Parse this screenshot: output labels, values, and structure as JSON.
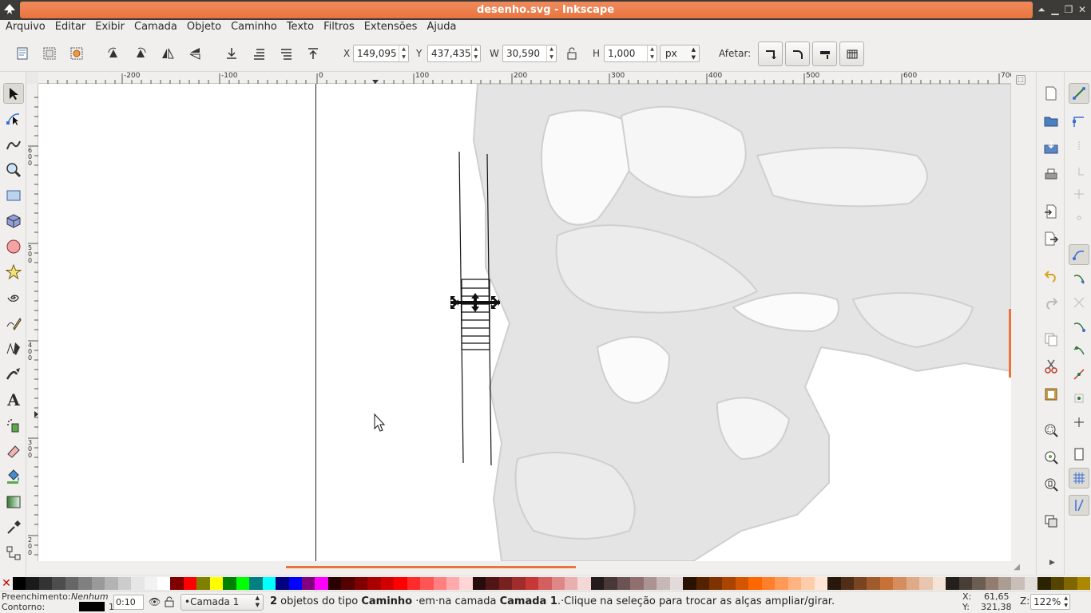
{
  "window": {
    "title": "desenho.svg - Inkscape"
  },
  "menu": [
    "Arquivo",
    "Editar",
    "Exibir",
    "Camada",
    "Objeto",
    "Caminho",
    "Texto",
    "Filtros",
    "Extensões",
    "Ajuda"
  ],
  "toolbar": {
    "x_label": "X",
    "x_value": "149,095",
    "y_label": "Y",
    "y_value": "437,435",
    "w_label": "W",
    "w_value": "30,590",
    "h_label": "H",
    "h_value": "1,000",
    "unit": "px",
    "affect_label": "Afetar:"
  },
  "ruler": {
    "h_ticks": [
      "-200",
      "-100",
      "0",
      "100",
      "200",
      "300",
      "400",
      "500",
      "600",
      "700"
    ],
    "v_ticks": [
      "6",
      "0",
      "0",
      "5",
      "0",
      "0",
      "4",
      "0",
      "0",
      "3",
      "0",
      "0",
      "2",
      "0",
      "0"
    ]
  },
  "palette": [
    "#000000",
    "#1a1a1a",
    "#333333",
    "#4d4d4d",
    "#666666",
    "#808080",
    "#999999",
    "#b3b3b3",
    "#cccccc",
    "#e6e6e6",
    "#f2f2f2",
    "#ffffff",
    "#800000",
    "#ff0000",
    "#808000",
    "#ffff00",
    "#008000",
    "#00ff00",
    "#008080",
    "#00ffff",
    "#000080",
    "#0000ff",
    "#800080",
    "#ff00ff",
    "#2b0000",
    "#550000",
    "#800000",
    "#aa0000",
    "#d40000",
    "#ff0000",
    "#ff2a2a",
    "#ff5555",
    "#ff8080",
    "#ffaaaa",
    "#ffd5d5",
    "#280b0b",
    "#501616",
    "#782121",
    "#a02c2c",
    "#c83737",
    "#d35f5f",
    "#de8787",
    "#e9afaf",
    "#f4d7d7",
    "#241c1c",
    "#483737",
    "#6c5353",
    "#916f6f",
    "#ac9393",
    "#c8b7b7",
    "#e3dbdb",
    "#2b1100",
    "#552200",
    "#803300",
    "#aa4400",
    "#d45500",
    "#ff6600",
    "#ff7f2a",
    "#ff9955",
    "#ffb380",
    "#ffccaa",
    "#ffe6d5",
    "#28170b",
    "#502d16",
    "#784421",
    "#a05a2c",
    "#c87137",
    "#d38d5f",
    "#deaa87",
    "#e9c6af",
    "#f4e3d7",
    "#241f1c",
    "#483e37",
    "#6c5d53",
    "#917c6f",
    "#ac9d93",
    "#c8beb7",
    "#e3dedb",
    "#2b2200",
    "#554400",
    "#806600",
    "#aa8800"
  ],
  "status": {
    "fill_label": "Preenchimento:",
    "fill_value": "Nenhum",
    "stroke_label": "Contorno:",
    "stroke_width": "1",
    "opacity": "0:10",
    "layer": "•Camada 1",
    "message_count": "2",
    "message_p1": " objetos do tipo ",
    "message_type": "Caminho",
    "message_p2": " ·em·na camada ",
    "message_layer": "Camada 1",
    "message_p3": ".·Clique na seleção para trocar as alças ampliar/girar.",
    "cursor_x_label": "X:",
    "cursor_x": "61,65",
    "cursor_y_label": "Y:",
    "cursor_y": "321,38",
    "zoom_label": "Z:",
    "zoom": "122%"
  },
  "colors": {
    "accent": "#e9743e",
    "titlebar": "#3c3b37",
    "sketch": "#d9d9d9"
  }
}
